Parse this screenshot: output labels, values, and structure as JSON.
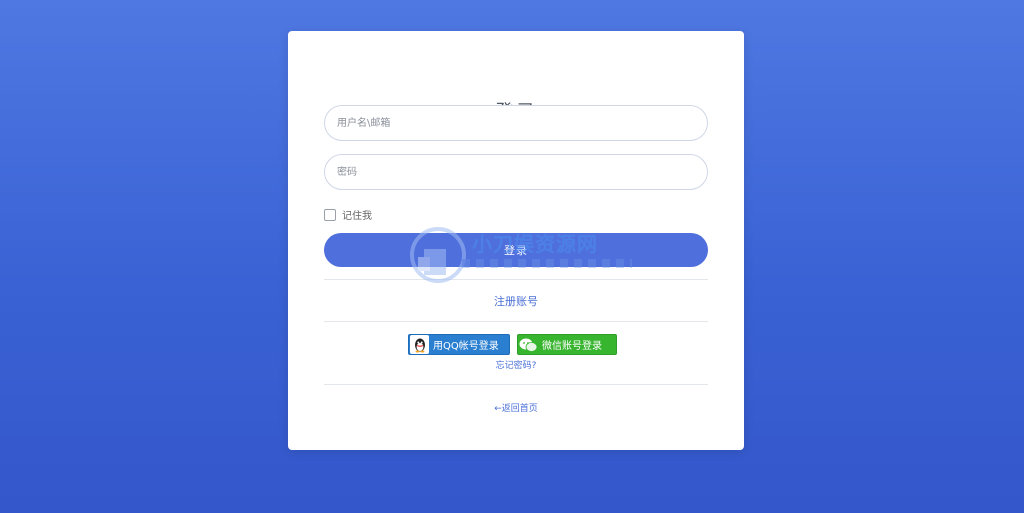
{
  "login": {
    "title": "登录",
    "username_placeholder": "用户名\\邮箱",
    "password_placeholder": "密码",
    "remember_label": "记住我",
    "login_button": "登录",
    "register_link": "注册账号",
    "qq_login": "用QQ帐号登录",
    "wechat_login": "微信账号登录",
    "forgot_link": "忘记密码?",
    "back_link": "←返回首页"
  },
  "watermark": {
    "text": "小刀娱资源网"
  },
  "colors": {
    "background_top": "#4f78e2",
    "background_bottom": "#3457cb",
    "accent": "#4f6fdc",
    "link": "#4a6fd6",
    "qq": "#2a7fd1",
    "wechat": "#38b52f"
  },
  "icons": {
    "qq": "qq-penguin-icon",
    "wechat": "wechat-bubbles-icon"
  }
}
